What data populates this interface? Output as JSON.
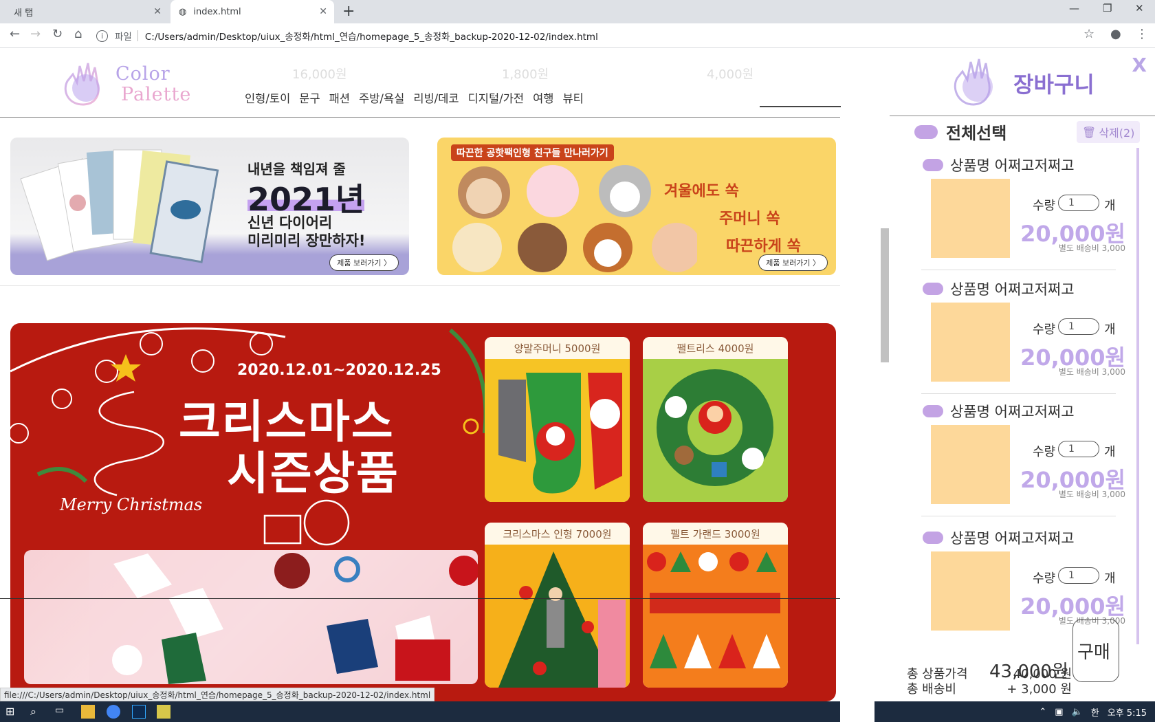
{
  "browser": {
    "tabs": [
      {
        "label": "새 탭"
      },
      {
        "label": "index.html"
      }
    ],
    "new_tab": "+",
    "window_controls": {
      "minimize": "—",
      "restore": "❐",
      "close": "✕"
    },
    "address": {
      "scheme": "파일",
      "url": "C:/Users/admin/Desktop/uiux_송정화/html_연습/homepage_5_송정화_backup-2020-12-02/index.html"
    },
    "status_url": "file:///C:/Users/admin/Desktop/uiux_송정화/html_연습/homepage_5_송정화_backup-2020-12-02/index.html"
  },
  "ghost_prices": [
    "16,000원",
    "1,800원",
    "4,000원"
  ],
  "header": {
    "logo_line1": "Color",
    "logo_line2": "Palette",
    "nav": [
      "인형/토이",
      "문구",
      "패션",
      "주방/욕실",
      "리빙/데코",
      "디지털/가전",
      "여행",
      "뷰티"
    ]
  },
  "banners": {
    "diary": {
      "line1": "내년을 책임져 줄",
      "line2": "2021년",
      "line3": "신년 다이어리",
      "line4": "미리미리 장만하자!",
      "button": "제품 보러가기 〉"
    },
    "doll": {
      "tag": "따끈한 공핫팩인형 친구들 만나러가기",
      "line1": "겨울에도 쏙",
      "line2": "주머니 쏙",
      "line3": "따끈하게 쏙",
      "button": "제품 보러가기 〉"
    }
  },
  "christmas": {
    "date": "2020.12.01~2020.12.25",
    "title1": "크리스마스",
    "title2": "시즌상품",
    "merry": "Merry Christmas",
    "cards": [
      {
        "caption": "양말주머니 5000원"
      },
      {
        "caption": "팰트리스 4000원"
      },
      {
        "caption": "크리스마스 인형 7000원"
      },
      {
        "caption": "펠트 가랜드 3000원"
      }
    ]
  },
  "cart": {
    "title": "장바구니",
    "close": "X",
    "select_all": "전체선택",
    "delete": "삭제(2)",
    "items": [
      {
        "name": "상품명 어쩌고저쩌고",
        "qty_label": "수량",
        "qty": "1",
        "unit": "개",
        "price": "20,000원",
        "shipping": "별도 배송비 3,000"
      },
      {
        "name": "상품명 어쩌고저쩌고",
        "qty_label": "수량",
        "qty": "1",
        "unit": "개",
        "price": "20,000원",
        "shipping": "별도 배송비 3,000"
      },
      {
        "name": "상품명 어쩌고저쩌고",
        "qty_label": "수량",
        "qty": "1",
        "unit": "개",
        "price": "20,000원",
        "shipping": "별도 배송비 3,000"
      },
      {
        "name": "상품명 어쩌고저쩌고",
        "qty_label": "수량",
        "qty": "1",
        "unit": "개",
        "price": "20,000원",
        "shipping": "별도 배송비 3,000"
      }
    ],
    "summary": {
      "product_label": "총 상품가격",
      "product_value": "40,000 원",
      "shipping_label": "총 배송비",
      "shipping_value": "+  3,000 원",
      "total": "43,000원"
    },
    "buy": "구매"
  },
  "taskbar": {
    "time": "오후 5:15",
    "ime": "한"
  },
  "colors": {
    "accent": "#8a6fd1",
    "price": "#c0a8e9",
    "xmas_red": "#b81a10",
    "thumb": "#fdd89a"
  }
}
